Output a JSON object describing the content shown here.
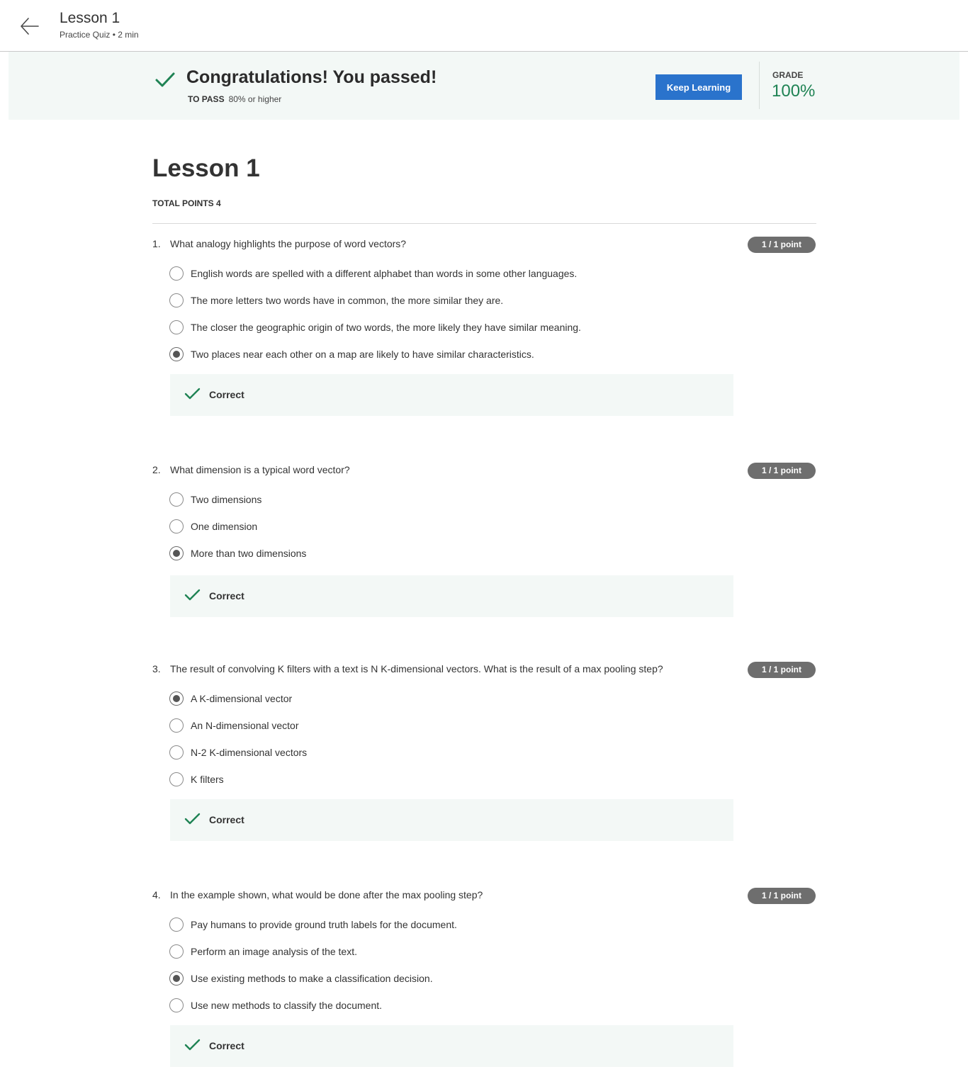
{
  "header": {
    "back_icon": "arrow-left-icon",
    "title": "Lesson 1",
    "subtitle": "Practice Quiz • 2 min"
  },
  "banner": {
    "icon": "checkmark-icon",
    "headline": "Congratulations! You passed!",
    "to_pass_label": "TO PASS",
    "to_pass_value": "80% or higher",
    "keep_learning_label": "Keep Learning",
    "grade_label": "GRADE",
    "grade_value": "100%",
    "accent_color": "#1f8354",
    "button_color": "#2a73cc"
  },
  "lesson": {
    "title": "Lesson 1",
    "total_points": "TOTAL POINTS 4"
  },
  "questions": [
    {
      "number": "1.",
      "text": "What analogy highlights the purpose of word vectors?",
      "points": "1 / 1 point",
      "options": [
        {
          "label": "English words are spelled with a different alphabet than words in some other languages.",
          "selected": false
        },
        {
          "label": "The more letters two words have in common, the more similar they are.",
          "selected": false
        },
        {
          "label": "The closer the geographic origin of two words, the more likely they have similar meaning.",
          "selected": false
        },
        {
          "label": "Two places near each other on a map are likely to have similar characteristics.",
          "selected": true
        }
      ],
      "feedback": "Correct"
    },
    {
      "number": "2.",
      "text": "What dimension is a typical word vector?",
      "points": "1 / 1 point",
      "options": [
        {
          "label": "Two dimensions",
          "selected": false
        },
        {
          "label": "One dimension",
          "selected": false
        },
        {
          "label": "More than two dimensions",
          "selected": true
        }
      ],
      "feedback": "Correct"
    },
    {
      "number": "3.",
      "text": "The result of convolving K filters with a text is N K-dimensional vectors. What is the result of a max pooling step?",
      "points": "1 / 1 point",
      "options": [
        {
          "label": "A K-dimensional vector",
          "selected": true
        },
        {
          "label": "An N-dimensional vector",
          "selected": false
        },
        {
          "label": "N-2 K-dimensional vectors",
          "selected": false
        },
        {
          "label": "K filters",
          "selected": false
        }
      ],
      "feedback": "Correct"
    },
    {
      "number": "4.",
      "text": "In the example shown, what would be done after the max pooling step?",
      "points": "1 / 1 point",
      "options": [
        {
          "label": "Pay humans to provide ground truth labels for the document.",
          "selected": false
        },
        {
          "label": "Perform an image analysis of the text.",
          "selected": false
        },
        {
          "label": "Use existing methods to make a classification decision.",
          "selected": true
        },
        {
          "label": "Use new methods to classify the document.",
          "selected": false
        }
      ],
      "feedback": "Correct"
    }
  ]
}
